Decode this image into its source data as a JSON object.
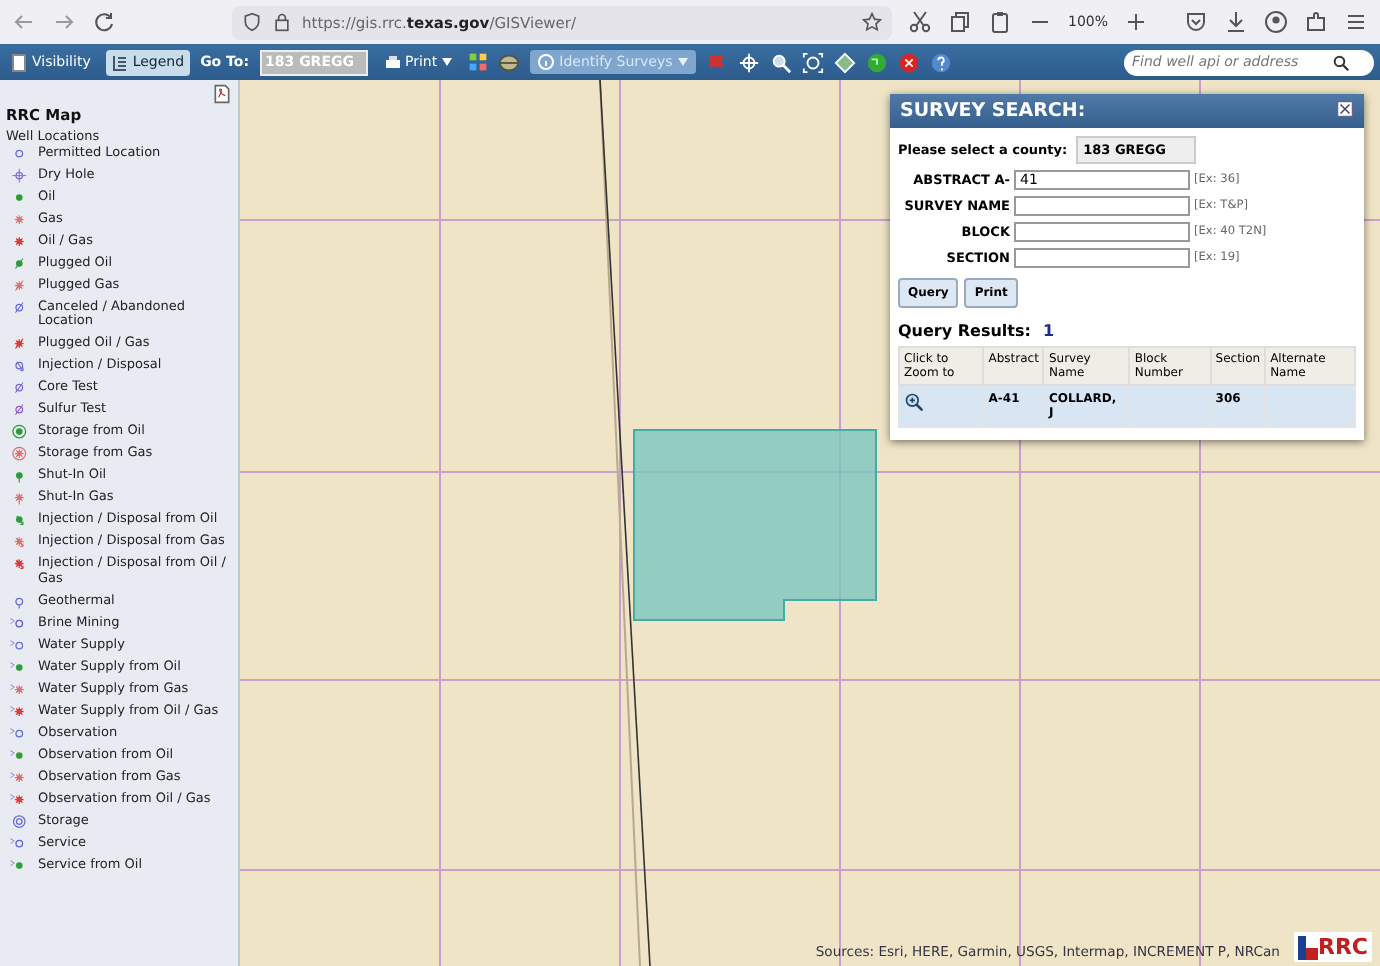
{
  "browser": {
    "url": "https://gis.rrc.**texas.gov**/GISViewer/",
    "zoom": "100%"
  },
  "toolbar": {
    "buttons": [
      {
        "label": "Visibility",
        "selected": false
      },
      {
        "label": "Legend",
        "selected": true
      }
    ],
    "goto_label": "Go To:",
    "goto_value": "183 GREGG",
    "print_label": "Print",
    "tool_label": "Identify Surveys",
    "search_placeholder": "Find well api or address"
  },
  "sidebar": {
    "title": "RRC Map",
    "section": "Well Locations",
    "items": [
      {
        "label": "Permitted Location",
        "kind": "plain-ring",
        "color": "#6a6ad8"
      },
      {
        "label": "Dry Hole",
        "kind": "cross-ring",
        "color": "#8a6ad8"
      },
      {
        "label": "Oil",
        "kind": "plain-dot",
        "color": "#2e9a3a"
      },
      {
        "label": "Gas",
        "kind": "plain-star",
        "color": "#e07070"
      },
      {
        "label": "Oil / Gas",
        "kind": "plain-burst",
        "color": "#e03b3b"
      },
      {
        "label": "Plugged Oil",
        "kind": "slashed-dot",
        "color": "#2e9a3a"
      },
      {
        "label": "Plugged Gas",
        "kind": "slashed-star",
        "color": "#e07070"
      },
      {
        "label": "Canceled / Abandoned Location",
        "kind": "slashed-ring",
        "color": "#6a6ad8"
      },
      {
        "label": "Plugged Oil / Gas",
        "kind": "slashed-burst",
        "color": "#e03b3b"
      },
      {
        "label": "Injection / Disposal",
        "kind": "arrow-ring",
        "color": "#6a6ad8"
      },
      {
        "label": "Core Test",
        "kind": "slashed-ring",
        "color": "#7a6ad8"
      },
      {
        "label": "Sulfur Test",
        "kind": "slashed-ring",
        "color": "#8a5ad8"
      },
      {
        "label": "Storage from Oil",
        "kind": "ringed-dot",
        "color": "#2e9a3a"
      },
      {
        "label": "Storage from Gas",
        "kind": "ringed-star",
        "color": "#e07070"
      },
      {
        "label": "Shut-In Oil",
        "kind": "stem-dot",
        "color": "#2e9a3a"
      },
      {
        "label": "Shut-In Gas",
        "kind": "stem-star",
        "color": "#e07070"
      },
      {
        "label": "Injection / Disposal from Oil",
        "kind": "arrow-dot",
        "color": "#2e9a3a"
      },
      {
        "label": "Injection / Disposal from Gas",
        "kind": "arrow-star",
        "color": "#e07070"
      },
      {
        "label": "Injection / Disposal from Oil / Gas",
        "kind": "arrow-burst",
        "color": "#e03b3b"
      },
      {
        "label": "Geothermal",
        "kind": "stem-ring",
        "color": "#6a6ad8"
      },
      {
        "label": "Brine Mining",
        "kind": "tagged-ring",
        "color": "#5a5ad0"
      },
      {
        "label": "Water Supply",
        "kind": "tagged-ring",
        "color": "#6a6ad8"
      },
      {
        "label": "Water Supply from Oil",
        "kind": "tagged-dot",
        "color": "#2e9a3a"
      },
      {
        "label": "Water Supply from Gas",
        "kind": "tagged-star",
        "color": "#e07070"
      },
      {
        "label": "Water Supply from Oil / Gas",
        "kind": "tagged-burst",
        "color": "#e03b3b"
      },
      {
        "label": "Observation",
        "kind": "tagged-ring",
        "color": "#5a6ad8"
      },
      {
        "label": "Observation from Oil",
        "kind": "tagged-dot",
        "color": "#3a9a3a"
      },
      {
        "label": "Observation from Gas",
        "kind": "tagged-star",
        "color": "#e06a6a"
      },
      {
        "label": "Observation from Oil / Gas",
        "kind": "tagged-burst",
        "color": "#e0403b"
      },
      {
        "label": "Storage",
        "kind": "double-ring",
        "color": "#6a6ad8"
      },
      {
        "label": "Service",
        "kind": "tagged-ring",
        "color": "#6060d8"
      },
      {
        "label": "Service from Oil",
        "kind": "tagged-dot",
        "color": "#30a03a"
      }
    ]
  },
  "survey_panel": {
    "title": "SURVEY SEARCH:",
    "county_label": "Please select a county:",
    "county": "183 GREGG",
    "fields": [
      {
        "label": "ABSTRACT A-",
        "value": "41",
        "example": "[Ex: 36]"
      },
      {
        "label": "SURVEY NAME",
        "example": "[Ex: T&P]"
      },
      {
        "label": "BLOCK",
        "example": "[Ex: 40 T2N]"
      },
      {
        "label": "SECTION",
        "example": "[Ex: 19]"
      }
    ],
    "buttons": [
      "Query",
      "Print"
    ],
    "results_label": "Query Results:",
    "results_count": "1",
    "table": {
      "columns": [
        "Click to Zoom to",
        "Abstract",
        "Survey Name",
        "Block Number",
        "Section",
        "Alternate Name"
      ],
      "rows": [
        {
          "abstract": "A-41",
          "survey_name": "COLLARD, J",
          "section": "306"
        }
      ]
    }
  },
  "map": {
    "attribution": "Sources: Esri, HERE, Garmin, USGS, Intermap, INCREMENT P, NRCan",
    "logo": "RRC"
  }
}
